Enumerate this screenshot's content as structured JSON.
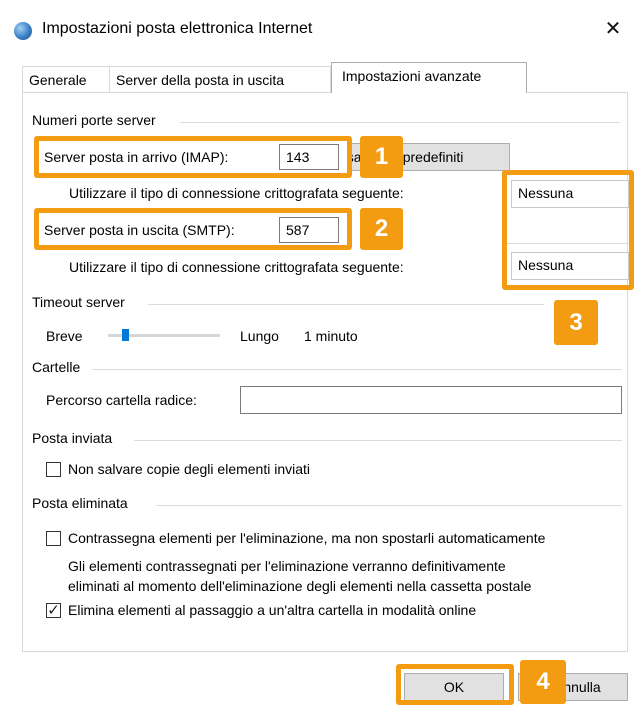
{
  "window": {
    "title": "Impostazioni posta elettronica Internet",
    "close_glyph": "✕",
    "app_icon": "globe-icon"
  },
  "tabs": [
    {
      "label": "Generale"
    },
    {
      "label": "Server della posta in uscita"
    },
    {
      "label": "Impostazioni avanzate"
    }
  ],
  "server_ports": {
    "section_label": "Numeri porte server",
    "imap_label": "Server posta in arrivo (IMAP):",
    "imap_value": "143",
    "defaults_button": "Usa valori predefiniti",
    "encryption_label_in": "Utilizzare il tipo di connessione crittografata seguente:",
    "encryption_value_in": "Nessuna",
    "smtp_label": "Server posta in uscita (SMTP):",
    "smtp_value": "587",
    "encryption_label_out": "Utilizzare il tipo di connessione crittografata seguente:",
    "encryption_value_out": "Nessuna"
  },
  "timeout": {
    "section_label": "Timeout server",
    "short_label": "Breve",
    "long_label": "Lungo",
    "value_label": "1 minuto",
    "slider_fraction": 0.15
  },
  "folders": {
    "section_label": "Cartelle",
    "root_path_label": "Percorso cartella radice:",
    "root_path_value": ""
  },
  "sent": {
    "section_label": "Posta inviata",
    "no_copies_label": "Non salvare copie degli elementi inviati",
    "no_copies_checked": false
  },
  "deleted": {
    "section_label": "Posta eliminata",
    "mark_label": "Contrassegna elementi per l'eliminazione, ma non spostarli automaticamente",
    "mark_checked": false,
    "info_line1": "Gli elementi contrassegnati per l'eliminazione verranno definitivamente",
    "info_line2": "eliminati al momento dell'eliminazione degli elementi nella cassetta postale",
    "purge_label": "Elimina elementi al passaggio a un'altra cartella in modalità online",
    "purge_checked": true,
    "check_glyph": "✓"
  },
  "footer": {
    "ok_label": "OK",
    "cancel_label": "Annulla"
  },
  "annotations": {
    "color": "#f39c12",
    "badges": [
      "1",
      "2",
      "3",
      "4"
    ]
  }
}
